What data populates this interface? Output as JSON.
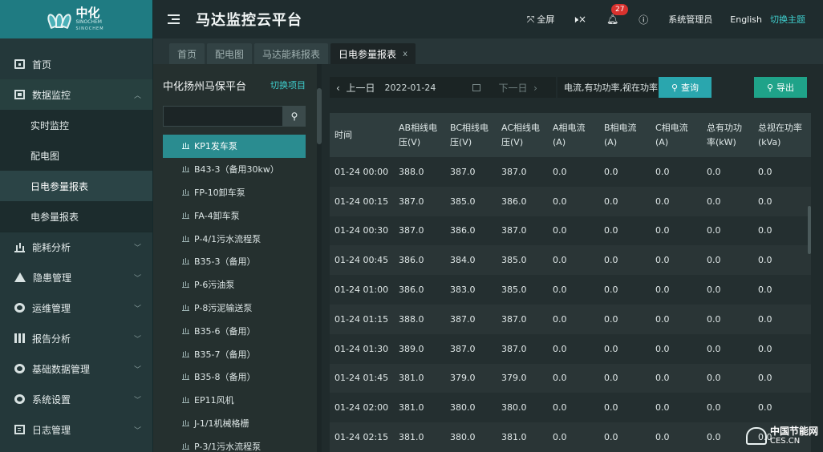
{
  "logo": {
    "name": "中化",
    "en": "SINOCHEM",
    "tagline": "SINOCHEM"
  },
  "header": {
    "title": "马达监控云平台",
    "fullscreen": "全屏",
    "notifications": "27",
    "user": "系统管理员",
    "language": "English",
    "theme": "切换主题"
  },
  "sidebar": {
    "items": [
      {
        "label": "首页"
      },
      {
        "label": "数据监控",
        "children": [
          "实时监控",
          "配电图",
          "日电参量报表",
          "电参量报表"
        ]
      },
      {
        "label": "能耗分析"
      },
      {
        "label": "隐患管理"
      },
      {
        "label": "运维管理"
      },
      {
        "label": "报告分析"
      },
      {
        "label": "基础数据管理"
      },
      {
        "label": "系统设置"
      },
      {
        "label": "日志管理"
      }
    ]
  },
  "tabs": [
    {
      "label": "首页"
    },
    {
      "label": "配电图"
    },
    {
      "label": "马达能耗报表"
    },
    {
      "label": "日电参量报表",
      "close": "x"
    }
  ],
  "devices": {
    "title": "中化扬州马保平台",
    "switch": "切换项目",
    "search_placeholder": "",
    "list": [
      "KP1发车泵",
      "B43-3（备用30kw）",
      "FP-10卸车泵",
      "FA-4卸车泵",
      "P-4/1污水流程泵",
      "B35-3（备用）",
      "P-6污油泵",
      "P-8污泥输送泵",
      "B35-6（备用）",
      "B35-7（备用）",
      "B35-8（备用）",
      "EP11风机",
      "J-1/1机械格栅",
      "P-3/1污水流程泵"
    ]
  },
  "toolbar": {
    "prev": "上一日",
    "date": "2022-01-24",
    "next": "下一日",
    "metric": "电流,有功功率,视在功率",
    "query": "查询",
    "export": "导出"
  },
  "table": {
    "headers": [
      "时间",
      "AB相线电压(V)",
      "BC相线电压(V)",
      "AC相线电压(V)",
      "A相电流(A)",
      "B相电流(A)",
      "C相电流(A)",
      "总有功功率(kW)",
      "总视在功率(kVa)"
    ],
    "rows": [
      [
        "01-24 00:00",
        "388.0",
        "387.0",
        "387.0",
        "0.0",
        "0.0",
        "0.0",
        "0.0",
        "0.0"
      ],
      [
        "01-24 00:15",
        "387.0",
        "385.0",
        "386.0",
        "0.0",
        "0.0",
        "0.0",
        "0.0",
        "0.0"
      ],
      [
        "01-24 00:30",
        "387.0",
        "386.0",
        "387.0",
        "0.0",
        "0.0",
        "0.0",
        "0.0",
        "0.0"
      ],
      [
        "01-24 00:45",
        "386.0",
        "384.0",
        "385.0",
        "0.0",
        "0.0",
        "0.0",
        "0.0",
        "0.0"
      ],
      [
        "01-24 01:00",
        "386.0",
        "383.0",
        "385.0",
        "0.0",
        "0.0",
        "0.0",
        "0.0",
        "0.0"
      ],
      [
        "01-24 01:15",
        "388.0",
        "387.0",
        "387.0",
        "0.0",
        "0.0",
        "0.0",
        "0.0",
        "0.0"
      ],
      [
        "01-24 01:30",
        "389.0",
        "387.0",
        "387.0",
        "0.0",
        "0.0",
        "0.0",
        "0.0",
        "0.0"
      ],
      [
        "01-24 01:45",
        "381.0",
        "379.0",
        "379.0",
        "0.0",
        "0.0",
        "0.0",
        "0.0",
        "0.0"
      ],
      [
        "01-24 02:00",
        "381.0",
        "380.0",
        "380.0",
        "0.0",
        "0.0",
        "0.0",
        "0.0",
        "0.0"
      ],
      [
        "01-24 02:15",
        "381.0",
        "380.0",
        "381.0",
        "0.0",
        "0.0",
        "0.0",
        "0.0",
        "0.0"
      ]
    ]
  },
  "watermark": {
    "cn": "中国节能网",
    "en": "CES.CN"
  }
}
